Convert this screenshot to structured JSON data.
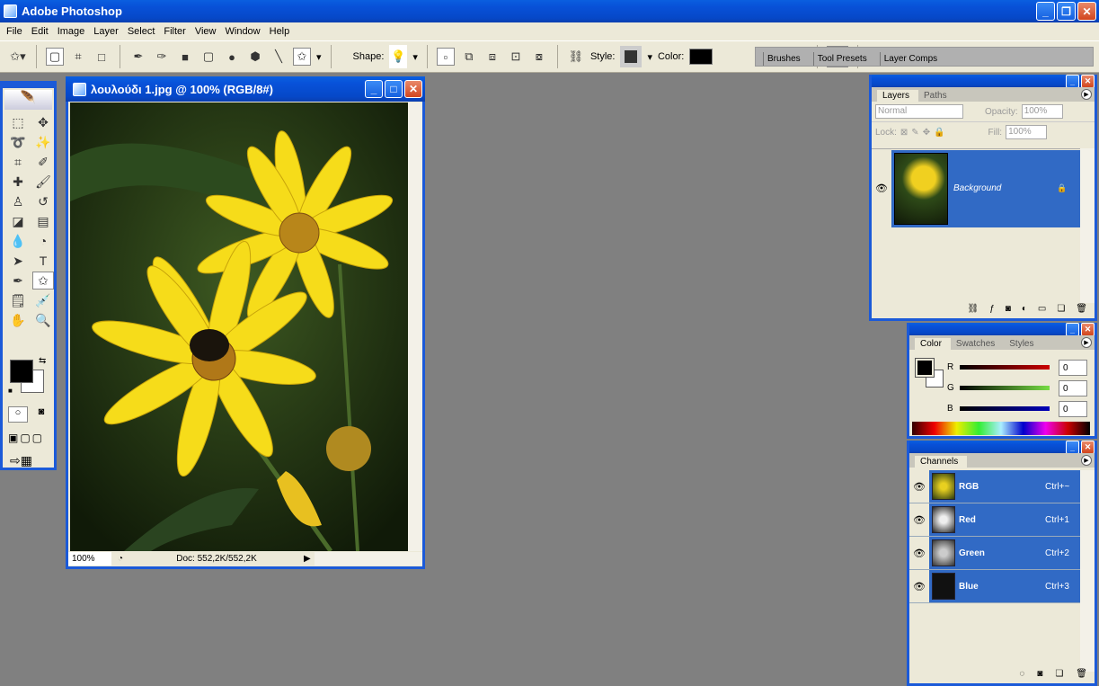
{
  "app": {
    "title": "Adobe Photoshop"
  },
  "menu": [
    "File",
    "Edit",
    "Image",
    "Layer",
    "Select",
    "Filter",
    "View",
    "Window",
    "Help"
  ],
  "options": {
    "shape_label": "Shape:",
    "style_label": "Style:",
    "color_label": "Color:",
    "color_value": "#000000"
  },
  "palette_well": [
    "Brushes",
    "Tool Presets",
    "Layer Comps"
  ],
  "document": {
    "title": "λουλούδι 1.jpg @ 100% (RGB/8#)",
    "zoom": "100%",
    "doc_info": "Doc: 552,2K/552,2K"
  },
  "layers": {
    "tabs": [
      "Layers",
      "Paths"
    ],
    "blend_mode": "Normal",
    "opacity_label": "Opacity:",
    "opacity": "100%",
    "lock_label": "Lock:",
    "fill_label": "Fill:",
    "fill": "100%",
    "items": [
      {
        "name": "Background",
        "locked": true,
        "visible": true
      }
    ]
  },
  "color": {
    "tabs": [
      "Color",
      "Swatches",
      "Styles"
    ],
    "channels": [
      {
        "label": "R",
        "value": "0"
      },
      {
        "label": "G",
        "value": "0"
      },
      {
        "label": "B",
        "value": "0"
      }
    ],
    "foreground": "#000000",
    "background": "#ffffff"
  },
  "channels": {
    "tabs": [
      "Channels"
    ],
    "items": [
      {
        "name": "RGB",
        "shortcut": "Ctrl+~"
      },
      {
        "name": "Red",
        "shortcut": "Ctrl+1"
      },
      {
        "name": "Green",
        "shortcut": "Ctrl+2"
      },
      {
        "name": "Blue",
        "shortcut": "Ctrl+3"
      }
    ]
  },
  "colors": {
    "title_bar": "#0a5fe0",
    "selection": "#316ac5",
    "workspace": "#808080"
  }
}
